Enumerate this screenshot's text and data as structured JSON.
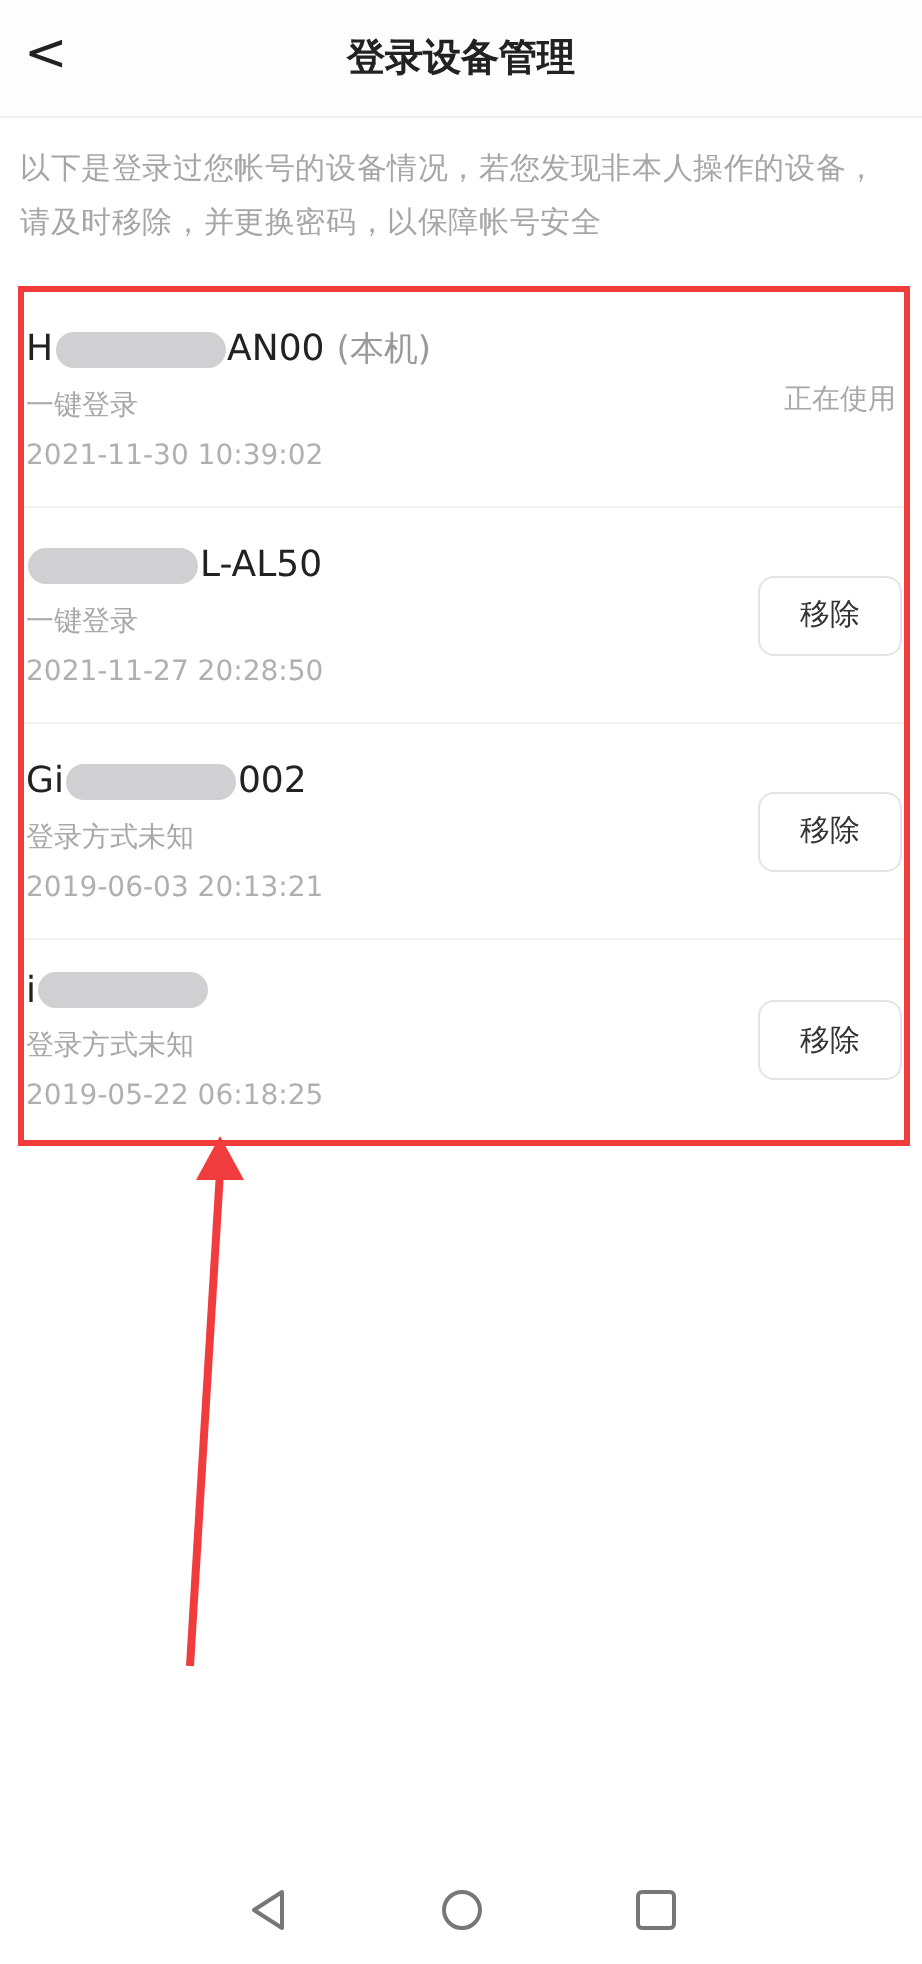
{
  "header": {
    "back": "<",
    "title": "登录设备管理"
  },
  "notice": "以下是登录过您帐号的设备情况，若您发现非本人操作的设备，请及时移除，并更换密码，以保障帐号安全",
  "devices": [
    {
      "kind": "current",
      "before_blur": "H",
      "after_blur": "AN00",
      "tag": "(本机)",
      "method": "一键登录",
      "time": "2021-11-30 10:39:02",
      "status": "正在使用"
    },
    {
      "kind": "other",
      "after_blur": "L-AL50",
      "method": "一键登录",
      "time": "2021-11-27 20:28:50",
      "action": "移除"
    },
    {
      "kind": "other",
      "before_blur": "Gi",
      "after_blur": "002",
      "method": "登录方式未知",
      "time": "2019-06-03 20:13:21",
      "action": "移除"
    },
    {
      "kind": "other",
      "before_blur": "i",
      "method": "登录方式未知",
      "time": "2019-05-22 06:18:25",
      "action": "移除"
    }
  ]
}
